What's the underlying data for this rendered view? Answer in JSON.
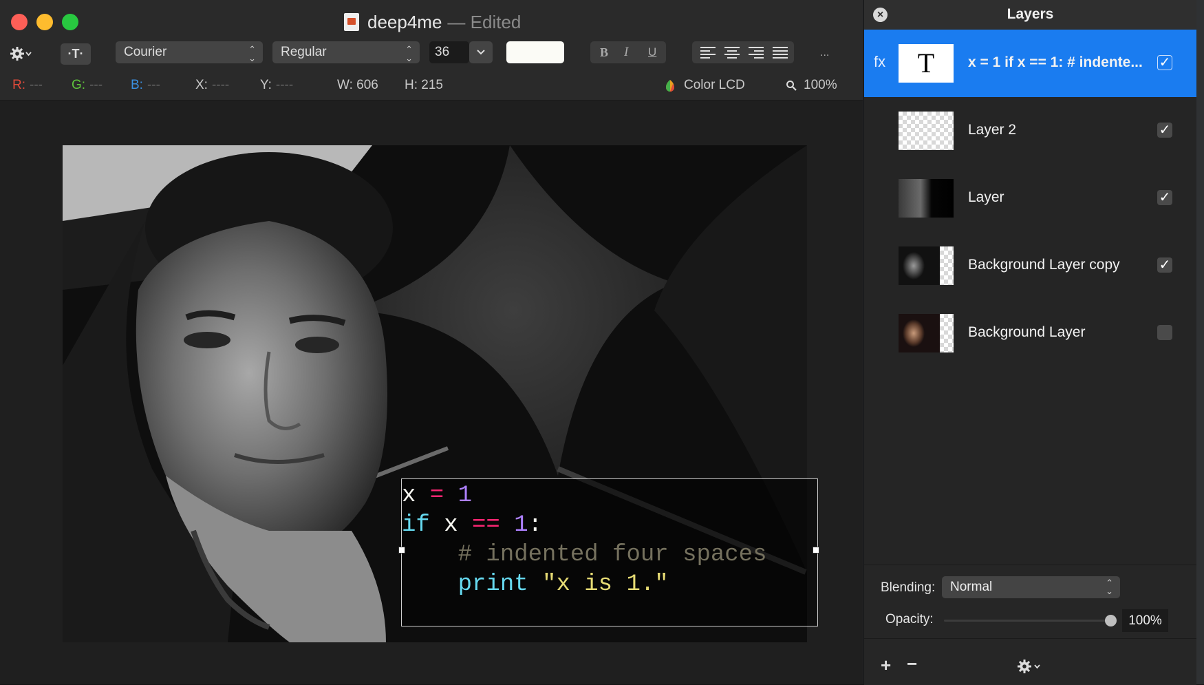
{
  "window": {
    "title": "deep4me",
    "title_suffix": "— Edited"
  },
  "toolbar": {
    "text_tool_label": "·T·",
    "font_family": "Courier",
    "font_style": "Regular",
    "font_size": "36",
    "bold_label": "B",
    "italic_label": "I",
    "underline_label": "U",
    "more_label": "..."
  },
  "infobar": {
    "r_label": "R:",
    "g_label": "G:",
    "b_label": "B:",
    "x_label": "X:",
    "y_label": "Y:",
    "w_label": "W:",
    "h_label": "H:",
    "short_dash": "---",
    "long_dash": "----",
    "w_value": "606",
    "h_value": "215",
    "color_profile": "Color LCD",
    "zoom": "100%",
    "colors": {
      "r": "#e04a3a",
      "g": "#5fc43c",
      "b": "#3a8fe0"
    }
  },
  "code": {
    "l1": {
      "a": "x",
      "b": " = ",
      "c": "1"
    },
    "l2": {
      "a": "if",
      "b": " x ",
      "c": "==",
      "d": " 1",
      "e": ":"
    },
    "l3": "    # indented four spaces",
    "l4": {
      "indent": "    ",
      "a": "print",
      "b": " \"x is 1.\""
    }
  },
  "layers_panel": {
    "title": "Layers",
    "fx_label": "fx",
    "text_thumb": "T",
    "layers": [
      {
        "name": "x = 1 if x == 1:     # indente...",
        "visible": true,
        "selected": true
      },
      {
        "name": "Layer 2",
        "visible": true
      },
      {
        "name": "Layer",
        "visible": true
      },
      {
        "name": "Background Layer copy",
        "visible": true
      },
      {
        "name": "Background Layer",
        "visible": false
      }
    ],
    "checkmark": "✓",
    "blending_label": "Blending:",
    "blending_value": "Normal",
    "opacity_label": "Opacity:",
    "opacity_value": "100%",
    "add_label": "+",
    "remove_label": "−"
  },
  "colors": {
    "accent": "#1a7cf0",
    "close_light": "#fd5f57",
    "min_light": "#febc2e",
    "max_light": "#28c840"
  }
}
